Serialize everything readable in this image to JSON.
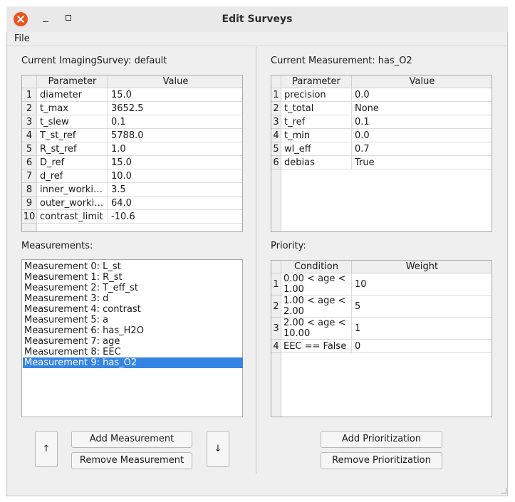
{
  "window": {
    "title": "Edit Surveys"
  },
  "menu": {
    "file": "File"
  },
  "survey": {
    "label": "Current ImagingSurvey: default",
    "headers": [
      "Parameter",
      "Value"
    ],
    "rows": [
      {
        "n": "1",
        "p": "diameter",
        "v": "15.0"
      },
      {
        "n": "2",
        "p": "t_max",
        "v": "3652.5"
      },
      {
        "n": "3",
        "p": "t_slew",
        "v": "0.1"
      },
      {
        "n": "4",
        "p": "T_st_ref",
        "v": "5788.0"
      },
      {
        "n": "5",
        "p": "R_st_ref",
        "v": "1.0"
      },
      {
        "n": "6",
        "p": "D_ref",
        "v": "15.0"
      },
      {
        "n": "7",
        "p": "d_ref",
        "v": "10.0"
      },
      {
        "n": "8",
        "p": "inner_workin...",
        "v": "3.5"
      },
      {
        "n": "9",
        "p": "outer_workin...",
        "v": "64.0"
      },
      {
        "n": "10",
        "p": "contrast_limit",
        "v": "-10.6"
      }
    ]
  },
  "measurement": {
    "label": "Current Measurement: has_O2",
    "headers": [
      "Parameter",
      "Value"
    ],
    "rows": [
      {
        "n": "1",
        "p": "precision",
        "v": "0.0"
      },
      {
        "n": "2",
        "p": "t_total",
        "v": "None"
      },
      {
        "n": "3",
        "p": "t_ref",
        "v": "0.1"
      },
      {
        "n": "4",
        "p": "t_min",
        "v": "0.0"
      },
      {
        "n": "5",
        "p": "wl_eff",
        "v": "0.7"
      },
      {
        "n": "6",
        "p": "debias",
        "v": "True"
      }
    ]
  },
  "measurements": {
    "label": "Measurements:",
    "items": [
      "Measurement 0: L_st",
      "Measurement 1: R_st",
      "Measurement 2: T_eff_st",
      "Measurement 3: d",
      "Measurement 4: contrast",
      "Measurement 5: a",
      "Measurement 6: has_H2O",
      "Measurement 7: age",
      "Measurement 8: EEC",
      "Measurement 9: has_O2"
    ],
    "selected_index": 9
  },
  "priority": {
    "label": "Priority:",
    "headers": [
      "Condition",
      "Weight"
    ],
    "rows": [
      {
        "n": "1",
        "c1": "0.00 < age <",
        "c2": "1.00",
        "w": "10"
      },
      {
        "n": "2",
        "c1": "1.00 < age <",
        "c2": "2.00",
        "w": "5"
      },
      {
        "n": "3",
        "c1": "2.00 < age <",
        "c2": "10.00",
        "w": "1"
      },
      {
        "n": "4",
        "c1": "EEC == False",
        "c2": "",
        "w": "0"
      }
    ]
  },
  "buttons": {
    "up": "↑",
    "down": "↓",
    "add_measurement": "Add Measurement",
    "remove_measurement": "Remove Measurement",
    "add_prioritization": "Add Prioritization",
    "remove_prioritization": "Remove Prioritization"
  }
}
